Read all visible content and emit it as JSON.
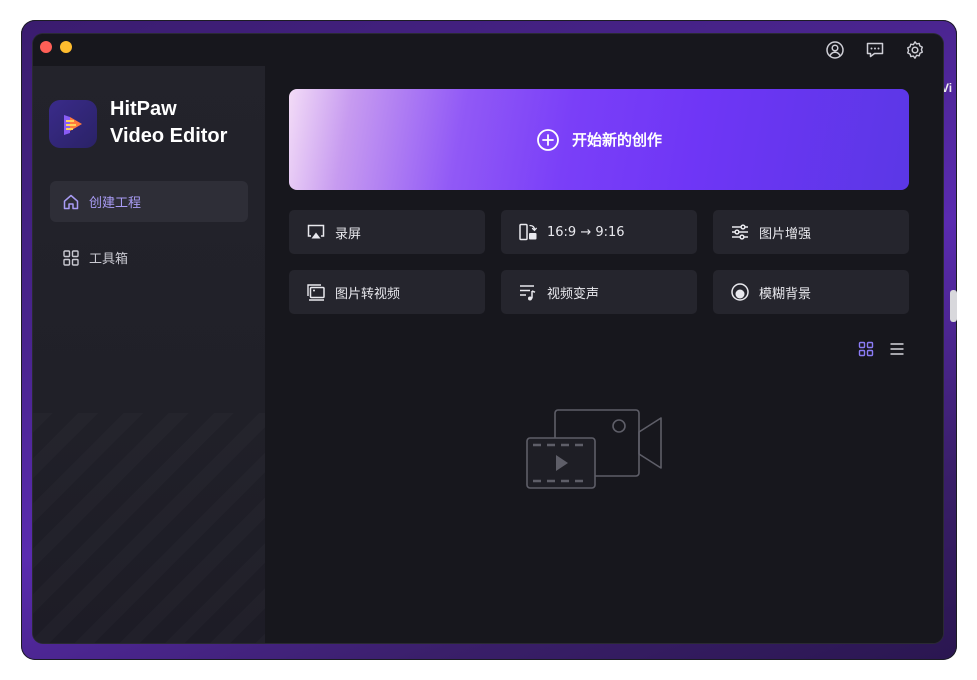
{
  "background": {
    "partial_text": "Vi"
  },
  "window": {
    "titlebar": {
      "icons": [
        "account-icon",
        "feedback-icon",
        "settings-icon"
      ]
    },
    "sidebar": {
      "brand_line1": "HitPaw",
      "brand_line2": "Video Editor",
      "items": [
        {
          "label": "创建工程",
          "icon": "home-icon",
          "active": true
        },
        {
          "label": "工具箱",
          "icon": "grid-icon",
          "active": false
        }
      ]
    },
    "main": {
      "hero": {
        "label": "开始新的创作",
        "icon": "plus-circle-icon"
      },
      "tools": [
        {
          "label": "录屏",
          "icon": "screen-record-icon"
        },
        {
          "label": "16:9 → 9:16",
          "icon": "aspect-ratio-icon"
        },
        {
          "label": "图片增强",
          "icon": "sliders-icon"
        },
        {
          "label": "图片转视频",
          "icon": "image-to-video-icon"
        },
        {
          "label": "视频变声",
          "icon": "voice-change-icon"
        },
        {
          "label": "模糊背景",
          "icon": "blur-background-icon"
        }
      ],
      "view_modes": {
        "grid": {
          "icon": "grid-view-icon",
          "active": true
        },
        "list": {
          "icon": "list-view-icon",
          "active": false
        }
      },
      "empty_state": {
        "icon": "empty-video-icon"
      }
    }
  },
  "colors": {
    "accent": "#8b7cf6",
    "window_bg": "#17171d",
    "sidebar_bg": "#23232b",
    "card_bg": "#25252d",
    "hero_start": "#f3dcf7",
    "hero_end": "#5b37e6"
  }
}
